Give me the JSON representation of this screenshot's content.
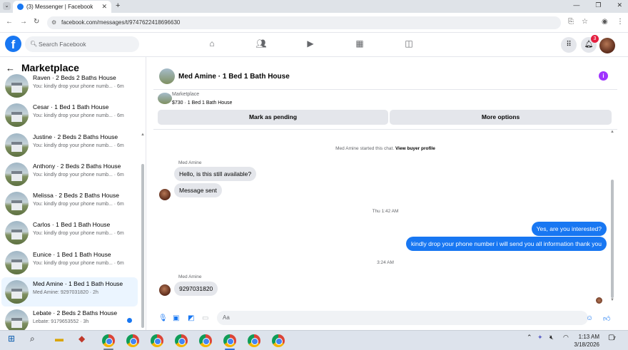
{
  "browser": {
    "tab_title": "(3) Messenger | Facebook",
    "url": "facebook.com/messages/t/9747622418696630"
  },
  "facebook": {
    "search_placeholder": "Search Facebook",
    "notification_count": "3"
  },
  "sidebar": {
    "title": "Marketplace",
    "items": [
      {
        "title": "Raven · 2 Beds 2 Baths House",
        "snippet": "You: kindly drop your phone numb... · 6m"
      },
      {
        "title": "Cesar · 1 Bed 1 Bath House",
        "snippet": "You: kindly drop your phone numb... · 6m"
      },
      {
        "title": "Justine · 2 Beds 2 Baths House",
        "snippet": "You: kindly drop your phone numb... · 6m"
      },
      {
        "title": "Anthony · 2 Beds 2 Baths House",
        "snippet": "You: kindly drop your phone numb... · 6m"
      },
      {
        "title": "Melissa · 2 Beds 2 Baths House",
        "snippet": "You: kindly drop your phone numb... · 6m"
      },
      {
        "title": "Carlos · 1 Bed 1 Bath House",
        "snippet": "You: kindly drop your phone numb... · 6m"
      },
      {
        "title": "Eunice · 1 Bed 1 Bath House",
        "snippet": "You: kindly drop your phone numb... · 6m"
      },
      {
        "title": "Med Amine · 1 Bed 1 Bath House",
        "snippet": "Med Amine: 9297031820 · 2h"
      },
      {
        "title": "Lebate · 2 Beds 2 Baths House",
        "snippet": "Lebate: 9179653552 · 3h"
      }
    ]
  },
  "chat": {
    "name": "Med Amine · 1 Bed 1 Bath House",
    "listing_label": "Marketplace",
    "listing_price": "$730 · 1 Bed 1 Bath House",
    "mark_pending": "Mark as pending",
    "more_options": "More options",
    "started": "Med Amine started this chat.",
    "view_profile": "View buyer profile",
    "sender": "Med Amine",
    "msg1": "Hello, is this still available?",
    "msg2": "Message sent",
    "time1": "Thu 1:42 AM",
    "out1": "Yes, are you interested?",
    "out2": "kindly drop your phone number i will send you all information thank you",
    "time2": "3:24 AM",
    "msg3": "9297031820",
    "input_placeholder": "Aa"
  },
  "taskbar": {
    "time": "1:13 AM",
    "date": "3/18/2026",
    "notif": "7"
  }
}
